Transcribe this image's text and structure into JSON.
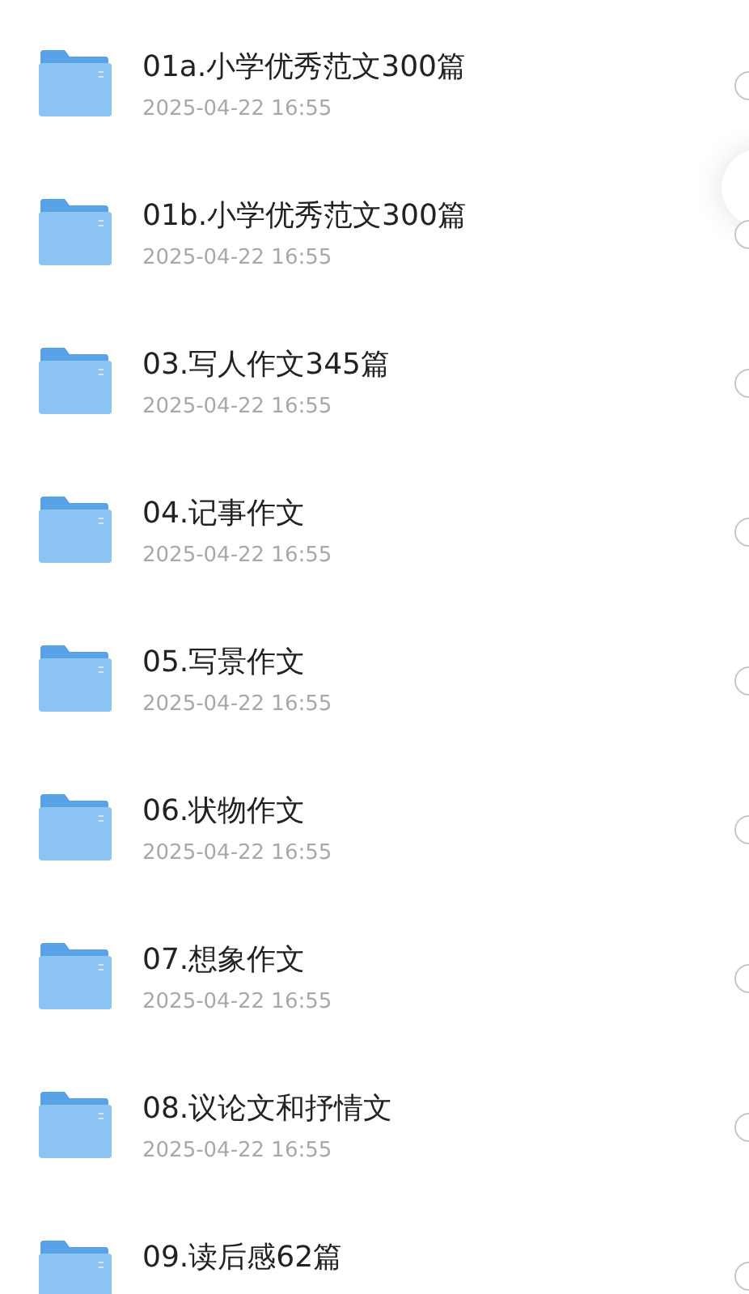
{
  "files": [
    {
      "name": "01a.小学优秀范文300篇",
      "date": "2025-04-22 16:55",
      "selected": false
    },
    {
      "name": "01b.小学优秀范文300篇",
      "date": "2025-04-22 16:55",
      "selected": false
    },
    {
      "name": "03.写人作文345篇",
      "date": "2025-04-22 16:55",
      "selected": false
    },
    {
      "name": "04.记事作文",
      "date": "2025-04-22 16:55",
      "selected": false
    },
    {
      "name": "05.写景作文",
      "date": "2025-04-22 16:55",
      "selected": false
    },
    {
      "name": "06.状物作文",
      "date": "2025-04-22 16:55",
      "selected": false
    },
    {
      "name": "07.想象作文",
      "date": "2025-04-22 16:55",
      "selected": false
    },
    {
      "name": "08.议论文和抒情文",
      "date": "2025-04-22 16:55",
      "selected": false
    },
    {
      "name": "09.读后感62篇",
      "selected": false
    }
  ]
}
